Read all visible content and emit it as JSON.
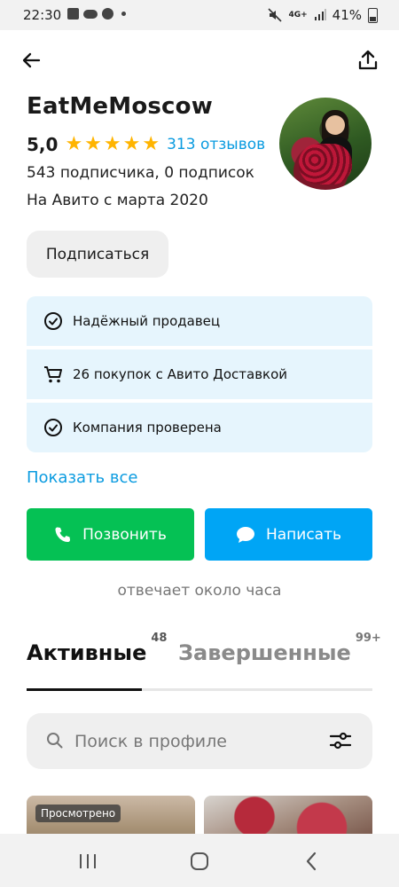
{
  "status_bar": {
    "time": "22:30",
    "network": "4G+",
    "battery": "41%"
  },
  "header": {
    "back_label": "back",
    "share_label": "share"
  },
  "profile": {
    "name": "EatMeMoscow",
    "rating": "5,0",
    "stars": 5,
    "reviews": "313 отзывов",
    "subscribers": "543 подписчика, 0 подписок",
    "since": "На Авито с марта 2020",
    "subscribe_label": "Подписаться"
  },
  "badges": [
    {
      "icon": "check-circle-icon",
      "text": "Надёжный продавец"
    },
    {
      "icon": "cart-icon",
      "text": "26 покупок с Авито Доставкой"
    },
    {
      "icon": "check-circle-icon",
      "text": "Компания проверена"
    }
  ],
  "show_all": "Показать все",
  "actions": {
    "call": "Позвонить",
    "write": "Написать",
    "call_color": "#05c154",
    "write_color": "#00a5f5"
  },
  "reply_time": "отвечает около часа",
  "tabs": [
    {
      "label": "Активные",
      "count": "48",
      "active": true
    },
    {
      "label": "Завершенные",
      "count": "99+",
      "active": false
    }
  ],
  "search": {
    "placeholder": "Поиск в профиле"
  },
  "cards": [
    {
      "badge": "Просмотрено"
    }
  ],
  "colors": {
    "accent_link": "#0a9be0",
    "star": "#ffb400",
    "badge_bg": "#e6f5fd"
  }
}
